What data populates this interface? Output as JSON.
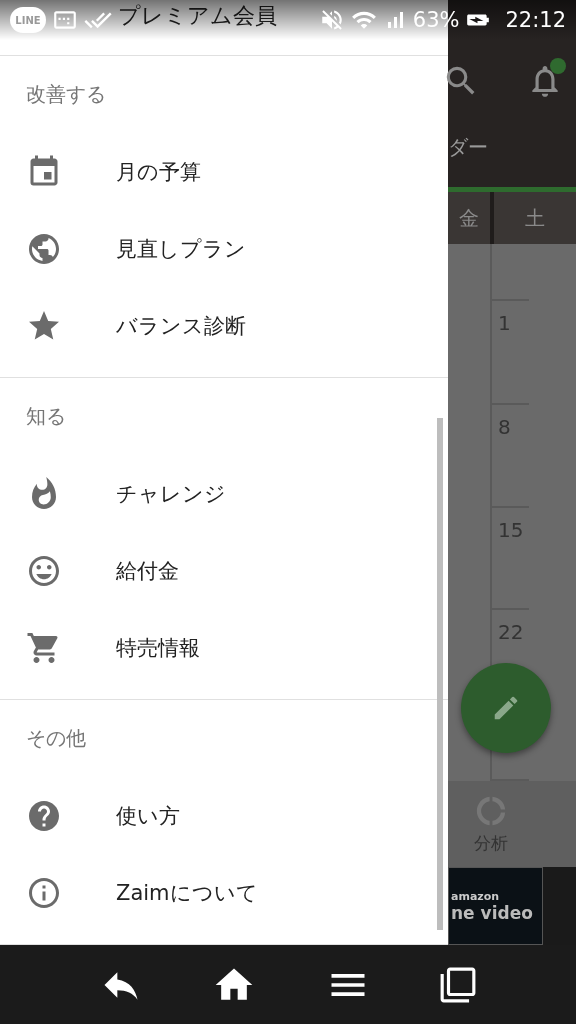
{
  "status_bar": {
    "app_badge": "LINE",
    "battery": "63%",
    "time": "22:12"
  },
  "drawer": {
    "account_label": "プレミアム会員",
    "sections": [
      {
        "title": "改善する",
        "items": [
          {
            "label": "月の予算"
          },
          {
            "label": "見直しプラン"
          },
          {
            "label": "バランス診断"
          }
        ]
      },
      {
        "title": "知る",
        "items": [
          {
            "label": "チャレンジ"
          },
          {
            "label": "給付金"
          },
          {
            "label": "特売情報"
          }
        ]
      },
      {
        "title": "その他",
        "items": [
          {
            "label": "使い方"
          },
          {
            "label": "Zaimについて"
          }
        ]
      }
    ]
  },
  "background_app": {
    "tab_label": "ダー",
    "weekdays": [
      "金",
      "土"
    ],
    "dates": [
      "1",
      "8",
      "15",
      "22"
    ],
    "nav_label": "分析",
    "ad": {
      "brand": "amazon",
      "text": "ne video"
    }
  }
}
